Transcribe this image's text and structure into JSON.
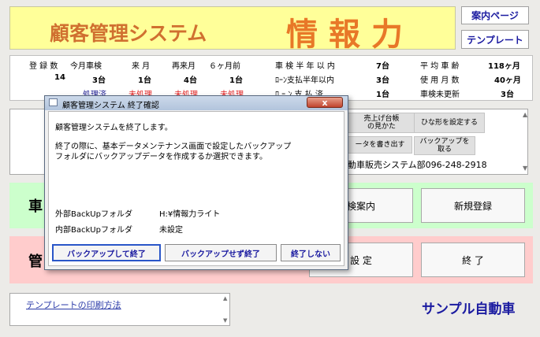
{
  "header": {
    "title1": "顧客管理システム",
    "title2": "情報力",
    "btn_guide": "案内ページ",
    "btn_template": "テンプレート"
  },
  "stats": {
    "h_reg": "登 録 数",
    "h_this": "今月車検",
    "h_next": "来  月",
    "h_next2": "再来月",
    "h_six": "６ヶ月前",
    "v_reg": "14",
    "v_this": "3台",
    "v_next": "1台",
    "v_next2": "4台",
    "v_six": "1台",
    "s_this": "処理済",
    "s_next": "未処理",
    "s_next2": "未処理",
    "s_six": "未処理",
    "m_l1": "車 検 半 年 以 内",
    "m_v1": "7台",
    "m_l2": "ﾛｰﾝ支払半年以内",
    "m_v2": "3台",
    "m_l3": "ﾛ ｰ ﾝ 支 払 済",
    "m_v3": "1台",
    "r_l1": "平 均 車 齢",
    "r_v1": "118ヶ月",
    "r_l2": "使 用 月 数",
    "r_v2": "40ヶ月",
    "r_l3": "車検未更新",
    "r_v3": "3台"
  },
  "mid": {
    "btn_a": "売上げ台帳\nの見かた",
    "btn_b": "ひな形を設定する",
    "btn_c": "ータを書き出す",
    "btn_d": "バックアップを\n取る",
    "info": "動車販売システム部096-248-2918"
  },
  "green": {
    "lbl": "車",
    "btn1": "検案内",
    "btn2": "新規登録"
  },
  "pink": {
    "lbl": "管",
    "btn1": "設  定",
    "btn2": "終  了"
  },
  "link": {
    "text": "テンプレートの印刷方法"
  },
  "brand": "サンプル自動車",
  "dialog": {
    "title": "顧客管理システム  終了確認",
    "close": "x",
    "line1": "顧客管理システムを終了します。",
    "line2": "終了の際に、基本データメンテナンス画面で設定したバックアップ",
    "line3": "フォルダにバックアップデータを作成するか選択できます。",
    "ext_label": "外部BackUpフォルダ",
    "ext_value": "H:¥情報力ライト",
    "int_label": "内部BackUpフォルダ",
    "int_value": "未設定",
    "btn_backup_exit": "バックアップして終了",
    "btn_nobackup_exit": "バックアップせず終了",
    "btn_cancel": "終了しない"
  }
}
